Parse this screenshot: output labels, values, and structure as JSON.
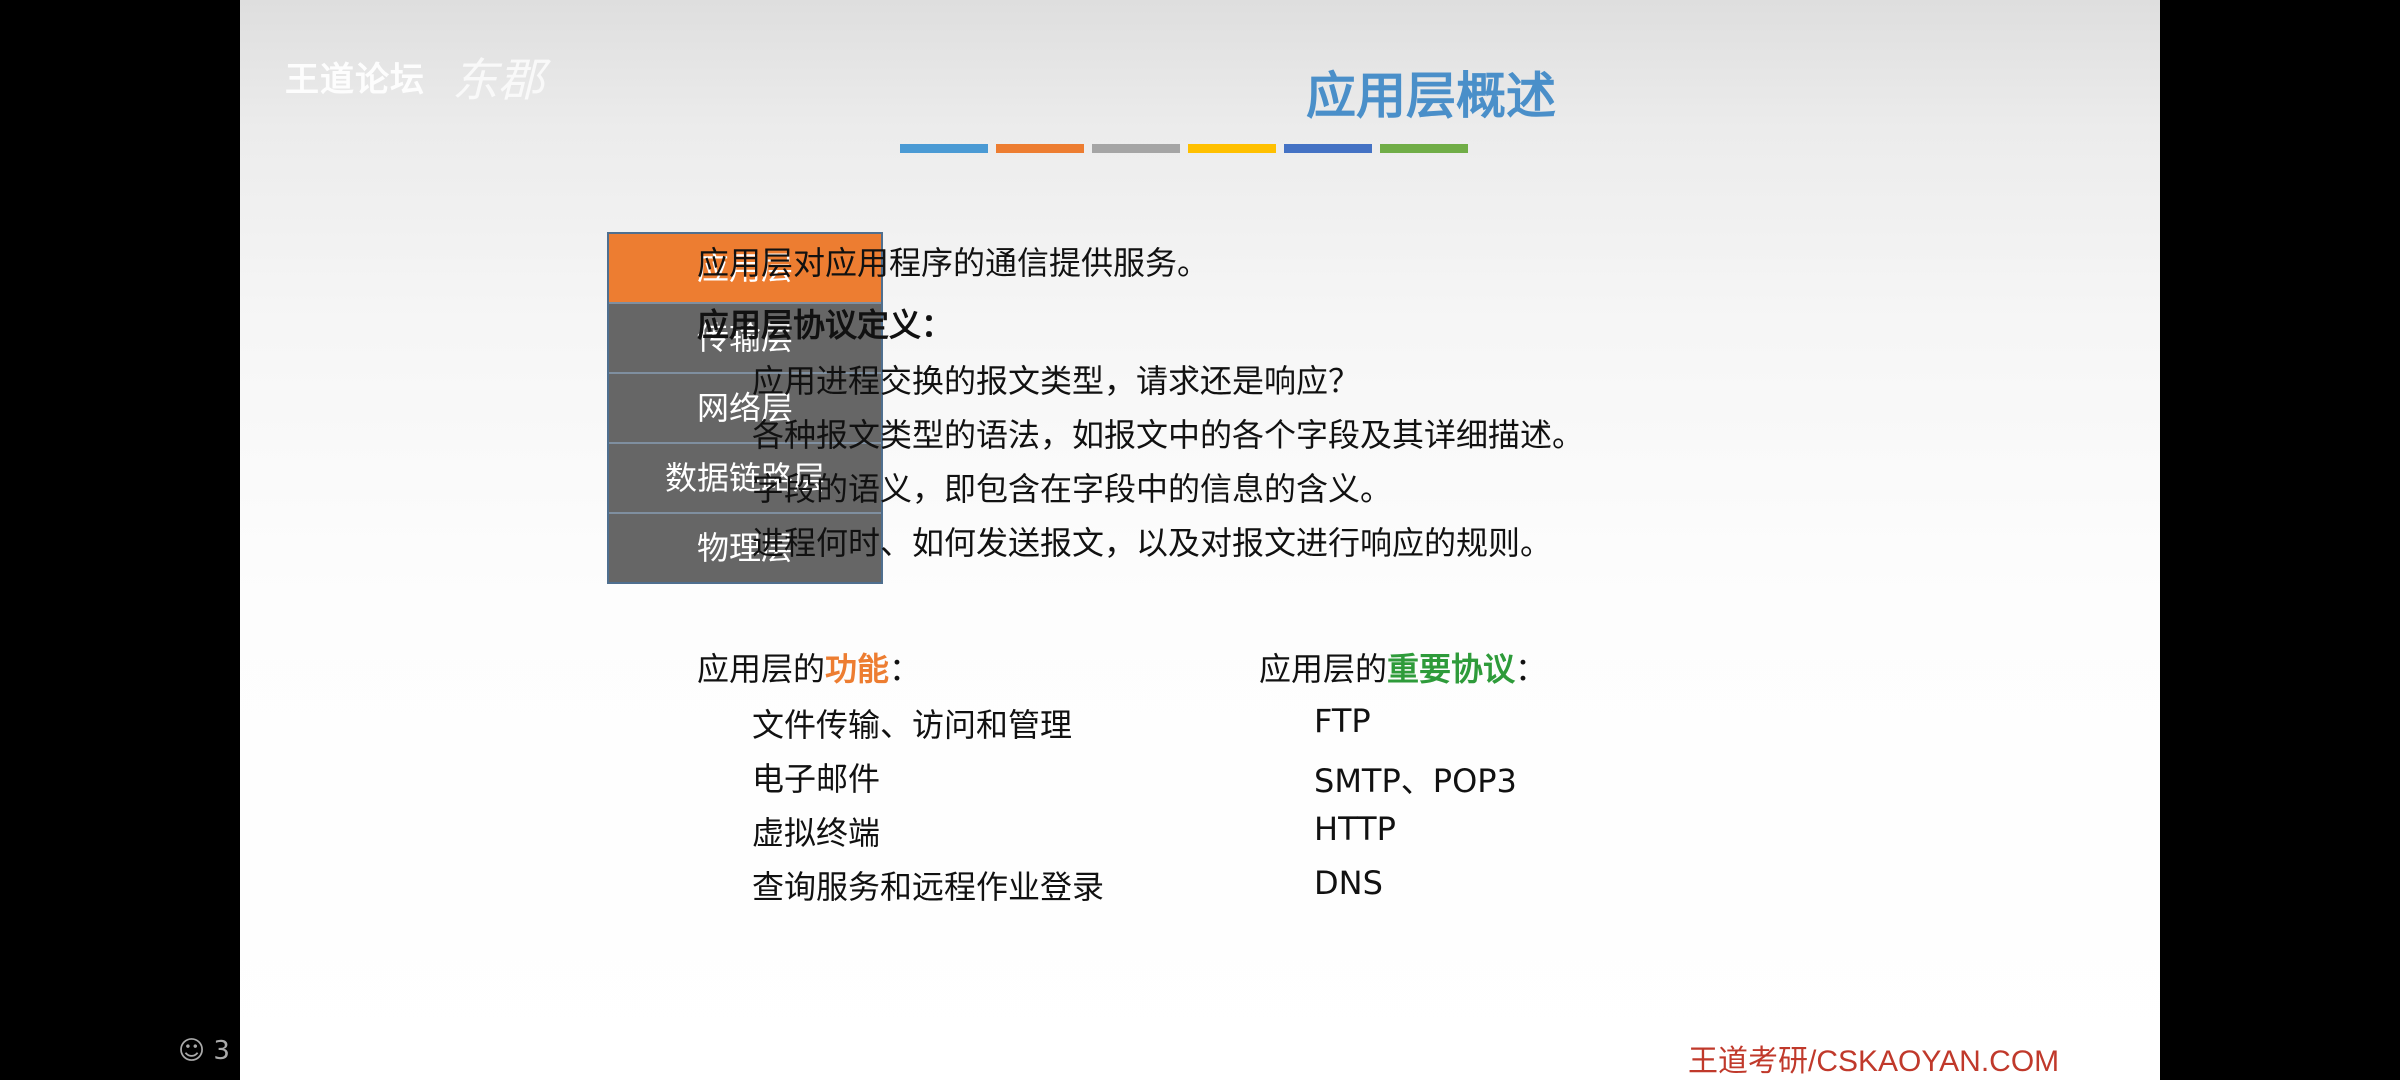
{
  "watermark": {
    "text": "王道论坛",
    "signature": "东郡"
  },
  "title": "应用层概述",
  "color_bars": [
    "#4a9ad4",
    "#ed7d31",
    "#a5a5a5",
    "#ffc000",
    "#4472c4",
    "#70ad47"
  ],
  "layers": [
    "应用层",
    "传输层",
    "网络层",
    "数据链路层",
    "物理层"
  ],
  "intro": "应用层对应用程序的通信提供服务。",
  "protocol_definition": {
    "heading": "应用层协议定义：",
    "items": [
      "应用进程交换的报文类型，请求还是响应？",
      "各种报文类型的语法，如报文中的各个字段及其详细描述。",
      "字段的语义，即包含在字段中的信息的含义。",
      "进程何时、如何发送报文，以及对报文进行响应的规则。"
    ]
  },
  "functions": {
    "prefix": "应用层的",
    "highlight": "功能",
    "suffix": "：",
    "items": [
      "文件传输、访问和管理",
      "电子邮件",
      "虚拟终端",
      "查询服务和远程作业登录"
    ]
  },
  "protocols": {
    "prefix": "应用层的",
    "highlight": "重要协议",
    "suffix": "：",
    "items": [
      "FTP",
      "SMTP、POP3",
      "HTTP",
      "DNS"
    ]
  },
  "footer": "王道考研/CSKAOYAN.COM",
  "side_indicator": {
    "icon": "people-icon",
    "count": "3"
  }
}
